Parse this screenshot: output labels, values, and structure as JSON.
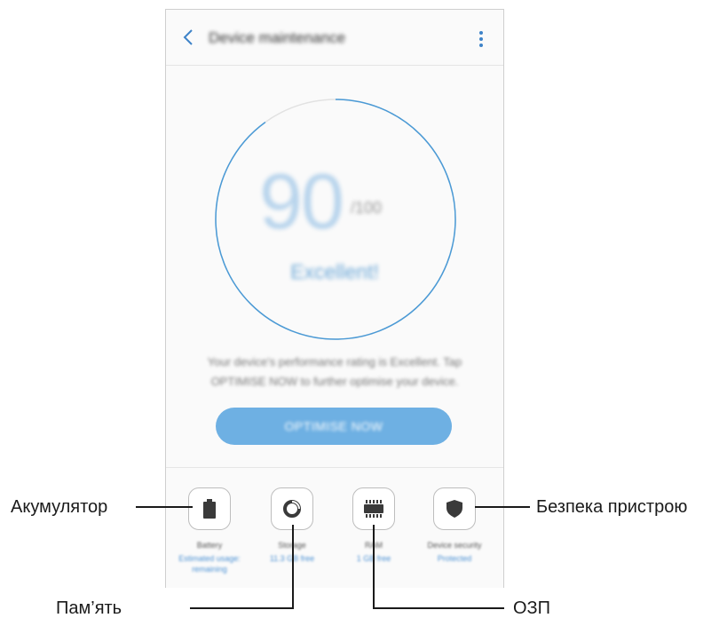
{
  "app": {
    "title": "Device maintenance",
    "back_icon": "chevron-left-icon",
    "more_icon": "more-vertical-icon"
  },
  "score": {
    "value": "90",
    "total": "/100",
    "rating": "Excellent!"
  },
  "description": "Your device's performance rating is Excellent. Tap OPTIMISE NOW to further optimise your device.",
  "optimize_button": {
    "label": "OPTIMISE NOW"
  },
  "categories": [
    {
      "name": "Battery",
      "status": "Estimated usage: remaining",
      "icon": "battery-icon"
    },
    {
      "name": "Storage",
      "status": "11.3 GB free",
      "icon": "storage-icon"
    },
    {
      "name": "RAM",
      "status": "1 GB free",
      "icon": "ram-chip-icon"
    },
    {
      "name": "Device security",
      "status": "Protected",
      "icon": "shield-icon"
    }
  ],
  "callouts": {
    "battery": "Акумулятор",
    "storage": "Пам’ять",
    "ram": "ОЗП",
    "security": "Безпека пристрою"
  },
  "colors": {
    "accent": "#6eb0e3",
    "ring": "#4a9ad6",
    "ring_track": "#e2e2e2",
    "icon": "#3a3a3a"
  }
}
